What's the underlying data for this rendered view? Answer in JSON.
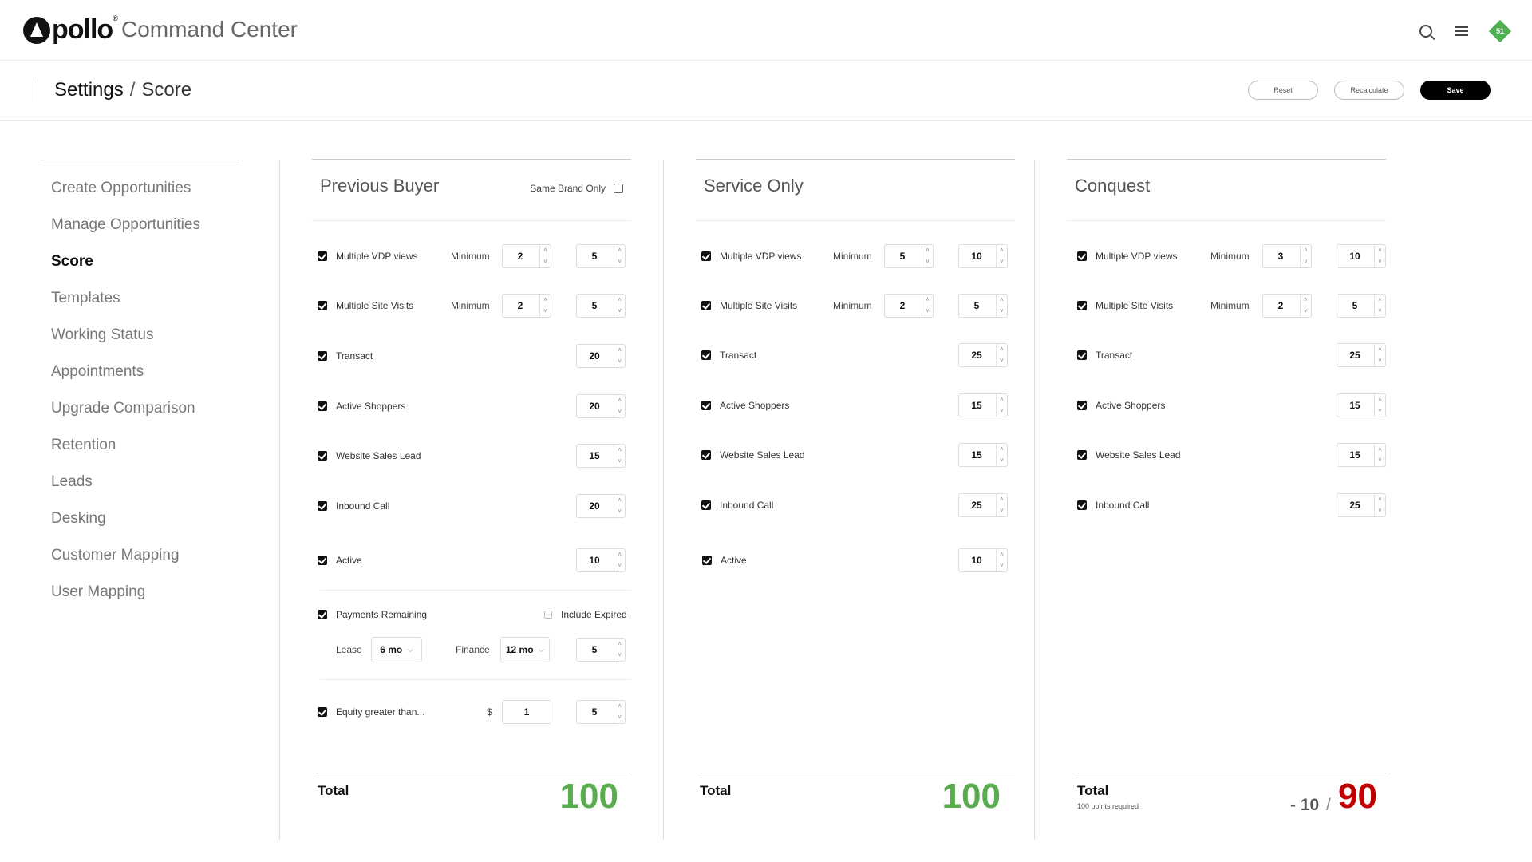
{
  "header": {
    "logo_text": "pollo",
    "logo_reg": "®",
    "app_name": "Command Center",
    "notification_badge": "51",
    "accent_color": "#4caf50"
  },
  "subheader": {
    "breadcrumb_root": "Settings",
    "breadcrumb_sep": "/",
    "breadcrumb_current": "Score",
    "reset_label": "Reset",
    "recalculate_label": "Recalculate",
    "save_label": "Save"
  },
  "sidebar": {
    "items": [
      {
        "label": "Create Opportunities"
      },
      {
        "label": "Manage Opportunities"
      },
      {
        "label": "Score"
      },
      {
        "label": "Templates"
      },
      {
        "label": "Working Status"
      },
      {
        "label": "Appointments"
      },
      {
        "label": "Upgrade Comparison"
      },
      {
        "label": "Retention"
      },
      {
        "label": "Leads"
      },
      {
        "label": "Desking"
      },
      {
        "label": "Customer Mapping"
      },
      {
        "label": "User Mapping"
      }
    ],
    "active_item": "Score"
  },
  "labels": {
    "minimum": "Minimum",
    "total": "Total"
  },
  "panels": [
    {
      "title": "Previous Buyer",
      "same_brand_label": "Same Brand Only",
      "rows": [
        {
          "label": "Multiple VDP views",
          "min": "2",
          "value": "5"
        },
        {
          "label": "Multiple Site Visits",
          "min": "2",
          "value": "5"
        },
        {
          "label": "Transact",
          "value": "20"
        },
        {
          "label": "Active Shoppers",
          "value": "20"
        },
        {
          "label": "Website Sales Lead",
          "value": "15"
        },
        {
          "label": "Inbound Call",
          "value": "20"
        },
        {
          "label": "Active",
          "value": "10"
        }
      ],
      "payments": {
        "label": "Payments Remaining",
        "include_expired_label": "Include Expired",
        "lease_label": "Lease",
        "lease_value": "6 mo",
        "finance_label": "Finance",
        "finance_value": "12 mo",
        "value": "5"
      },
      "equity": {
        "label": "Equity greater than...",
        "currency": "$",
        "amount": "1",
        "value": "5"
      },
      "total": "100"
    },
    {
      "title": "Service Only",
      "rows": [
        {
          "label": "Multiple VDP views",
          "min": "5",
          "value": "10"
        },
        {
          "label": "Multiple Site Visits",
          "min": "2",
          "value": "5"
        },
        {
          "label": "Transact",
          "value": "25"
        },
        {
          "label": "Active Shoppers",
          "value": "15"
        },
        {
          "label": "Website Sales Lead",
          "value": "15"
        },
        {
          "label": "Inbound Call",
          "value": "25"
        },
        {
          "label": "Active",
          "value": "10"
        }
      ],
      "total": "100"
    },
    {
      "title": "Conquest",
      "rows": [
        {
          "label": "Multiple VDP views",
          "min": "3",
          "value": "10"
        },
        {
          "label": "Multiple Site Visits",
          "min": "2",
          "value": "5"
        },
        {
          "label": "Transact",
          "value": "25"
        },
        {
          "label": "Active Shoppers",
          "value": "15"
        },
        {
          "label": "Website Sales Lead",
          "value": "15"
        },
        {
          "label": "Inbound Call",
          "value": "25"
        }
      ],
      "total_sub": "100 points required",
      "delta": "- 10",
      "slash": "/",
      "total": "90"
    }
  ],
  "colors": {
    "total_ok": "#5aad4e",
    "total_bad": "#c00000"
  }
}
